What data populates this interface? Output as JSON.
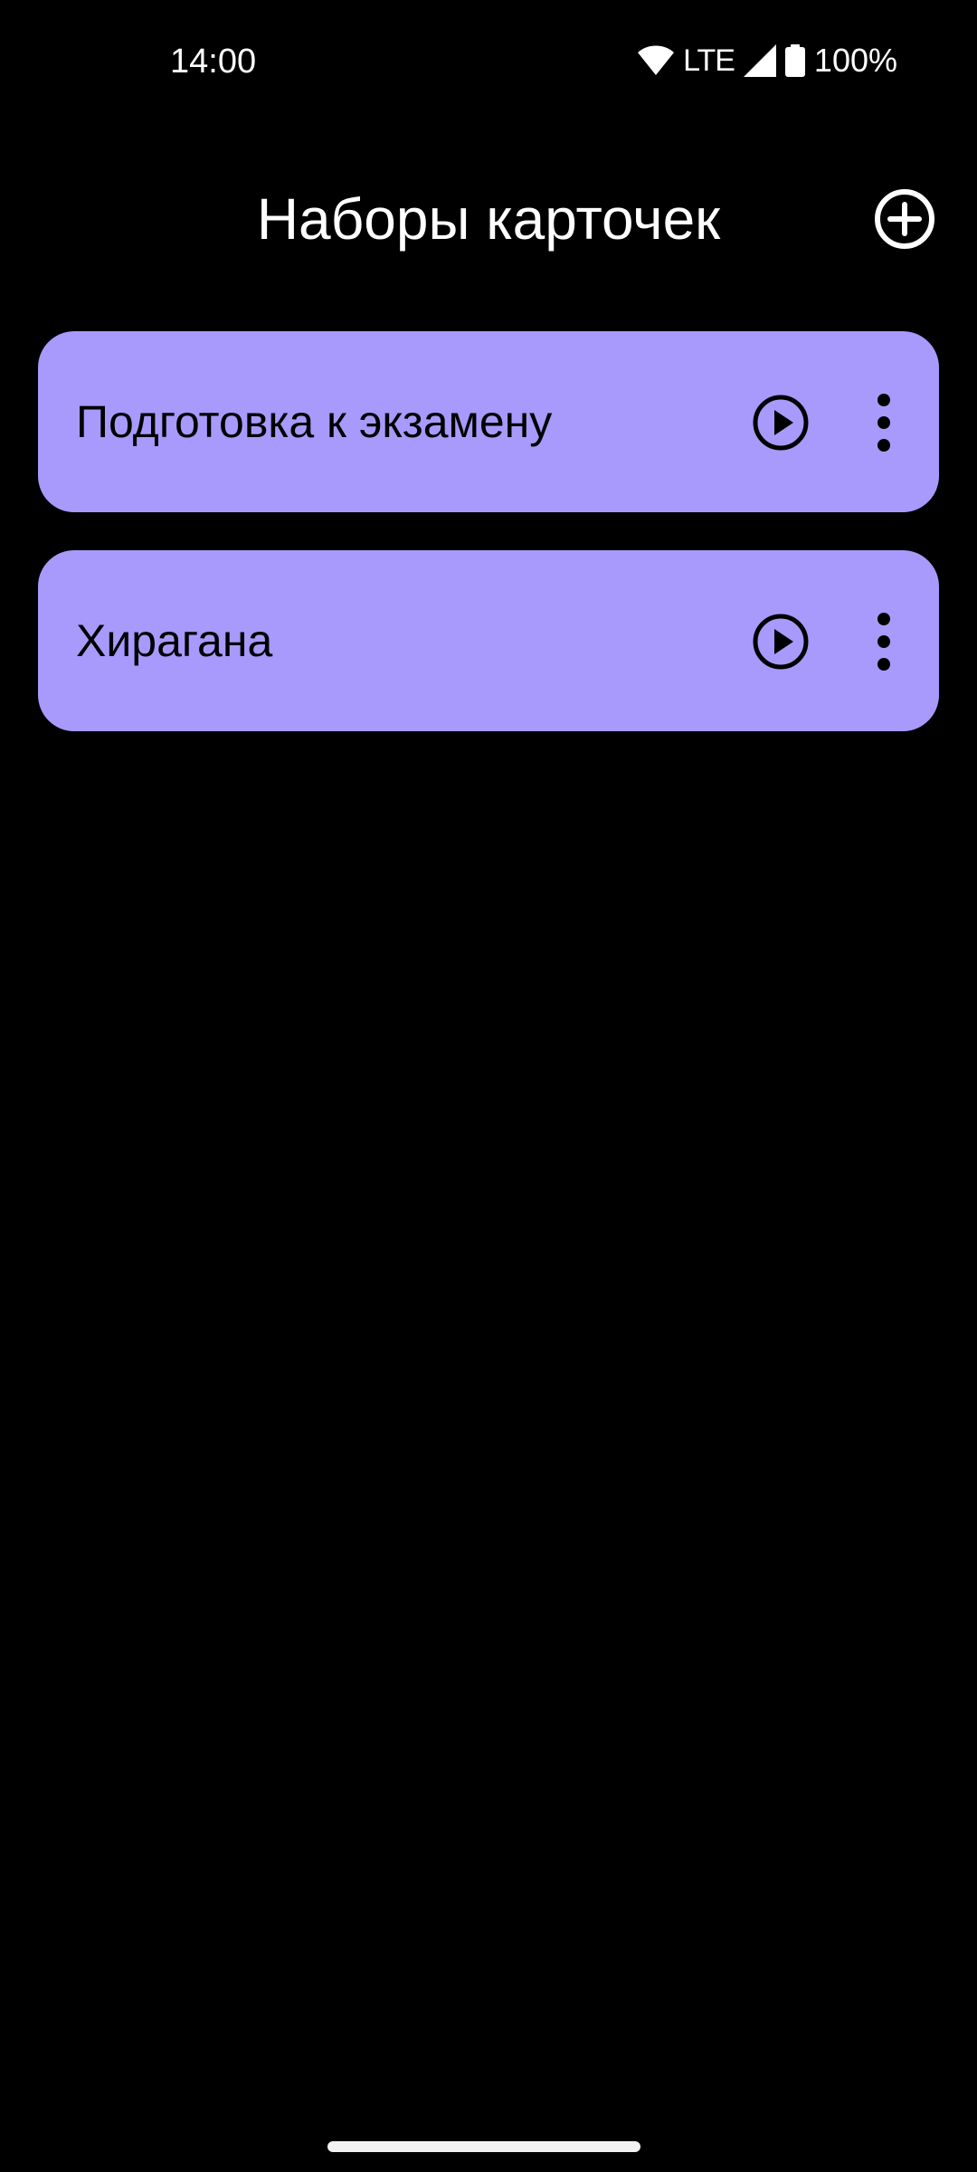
{
  "status_bar": {
    "time": "14:00",
    "network": "LTE",
    "battery": "100%",
    "icons": [
      "wifi-icon",
      "signal-icon",
      "battery-icon"
    ]
  },
  "header": {
    "title": "Наборы карточек",
    "add_icon": "plus-circle-icon"
  },
  "decks": [
    {
      "name": "Подготовка к экзамену",
      "play_icon": "play-circle-icon",
      "menu_icon": "more-vert-icon"
    },
    {
      "name": "Хирагана",
      "play_icon": "play-circle-icon",
      "menu_icon": "more-vert-icon"
    }
  ],
  "colors": {
    "background": "#000000",
    "card": "#a89afc",
    "card_text": "#000000",
    "header_text": "#ffffff"
  }
}
